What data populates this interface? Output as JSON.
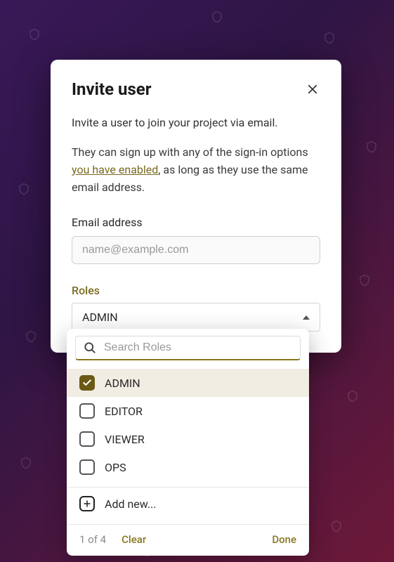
{
  "modal": {
    "title": "Invite user",
    "description1": "Invite a user to join your project via email.",
    "description2_before": "They can sign up with any of the sign-in options ",
    "description2_link": "you have enabled",
    "description2_after": ", as long as they use the same email address.",
    "emailLabel": "Email address",
    "emailPlaceholder": "name@example.com"
  },
  "roles": {
    "label": "Roles",
    "selected": "ADMIN",
    "searchPlaceholder": "Search Roles",
    "options": [
      {
        "label": "ADMIN",
        "checked": true
      },
      {
        "label": "EDITOR",
        "checked": false
      },
      {
        "label": "VIEWER",
        "checked": false
      },
      {
        "label": "OPS",
        "checked": false
      }
    ],
    "addNew": "Add new...",
    "countText": "1 of 4",
    "clear": "Clear",
    "done": "Done"
  }
}
